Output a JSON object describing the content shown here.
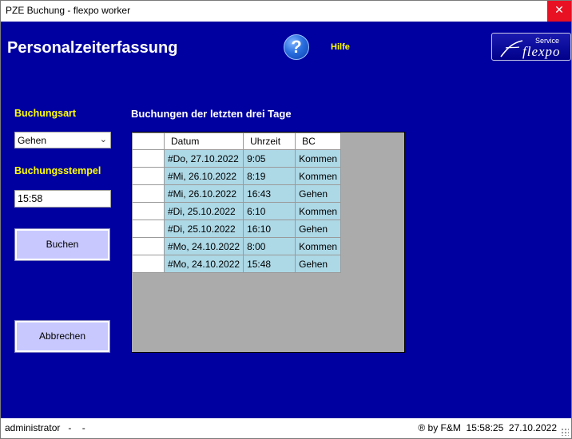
{
  "window": {
    "title": "PZE Buchung - flexpo worker",
    "close_glyph": "✕"
  },
  "header": {
    "app_title": "Personalzeiterfassung",
    "help_glyph": "?",
    "help_label": "Hilfe",
    "logo": {
      "service": "Service",
      "brand": "flexpo"
    }
  },
  "form": {
    "buchungsart_label": "Buchungsart",
    "buchungsart_value": "Gehen",
    "buchungsstempel_label": "Buchungsstempel",
    "buchungsstempel_value": "15:58",
    "buchen_label": "Buchen",
    "abbrechen_label": "Abbrechen"
  },
  "grid": {
    "title": "Buchungen der letzten drei Tage",
    "columns": [
      "Datum",
      "Uhrzeit",
      "BC"
    ],
    "rows": [
      [
        "#Do, 27.10.2022",
        "9:05",
        "Kommen"
      ],
      [
        "#Mi, 26.10.2022",
        "8:19",
        "Kommen"
      ],
      [
        "#Mi, 26.10.2022",
        "16:43",
        "Gehen"
      ],
      [
        "#Di, 25.10.2022",
        "6:10",
        "Kommen"
      ],
      [
        "#Di, 25.10.2022",
        "16:10",
        "Gehen"
      ],
      [
        "#Mo, 24.10.2022",
        "8:00",
        "Kommen"
      ],
      [
        "#Mo, 24.10.2022",
        "15:48",
        "Gehen"
      ]
    ]
  },
  "statusbar": {
    "user": "administrator   -    -",
    "info": "® by F&M  15:58:25  27.10.2022"
  },
  "colors": {
    "background": "#0000a0",
    "label": "#ffff00",
    "button": "#c8c8ff",
    "cell": "#add8e6",
    "grid_empty": "#ababab"
  }
}
